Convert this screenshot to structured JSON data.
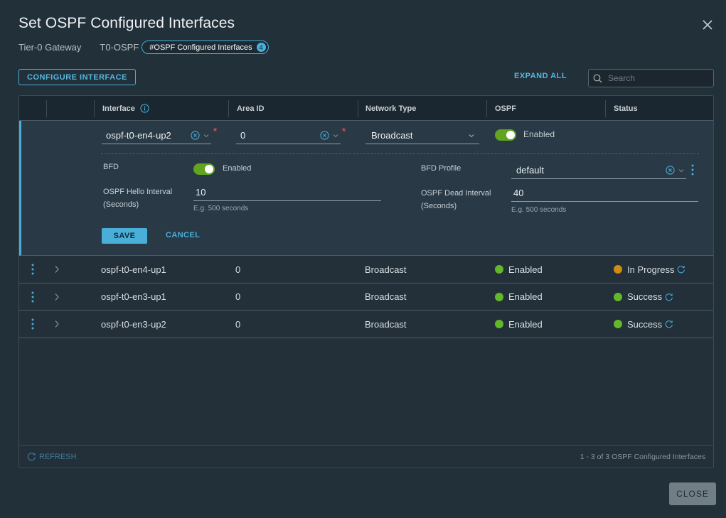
{
  "dialog": {
    "title": "Set OSPF Configured Interfaces",
    "breadcrumb": {
      "gateway_type": "Tier-0 Gateway",
      "gateway_name": "T0-OSPF",
      "pill_label": "#OSPF Configured Interfaces",
      "pill_count": "4"
    },
    "close_button": "CLOSE"
  },
  "toolbar": {
    "configure_label": "CONFIGURE INTERFACE",
    "expand_all_label": "EXPAND ALL",
    "search_placeholder": "Search",
    "search_value": ""
  },
  "grid": {
    "columns": [
      "Interface",
      "Area ID",
      "Network Type",
      "OSPF",
      "Status"
    ],
    "edit_row": {
      "interface": "ospf-t0-en4-up2",
      "area_id": "0",
      "network_type": "Broadcast",
      "ospf_toggle": true,
      "ospf_label": "Enabled",
      "bfd_label": "BFD",
      "bfd_toggle": true,
      "bfd_state": "Enabled",
      "bfd_profile_label": "BFD Profile",
      "bfd_profile_value": "default",
      "hello_label_1": "OSPF Hello Interval",
      "hello_label_2": "(Seconds)",
      "hello_value": "10",
      "hello_hint": "E.g. 500 seconds",
      "dead_label_1": "OSPF Dead Interval",
      "dead_label_2": "(Seconds)",
      "dead_value": "40",
      "dead_hint": "E.g. 500 seconds",
      "save_label": "SAVE",
      "cancel_label": "CANCEL"
    },
    "rows": [
      {
        "interface": "ospf-t0-en4-up1",
        "area_id": "0",
        "network_type": "Broadcast",
        "ospf": "Enabled",
        "ospf_color": "#62b72a",
        "status": "In Progress",
        "status_color": "#d18b0f"
      },
      {
        "interface": "ospf-t0-en3-up1",
        "area_id": "0",
        "network_type": "Broadcast",
        "ospf": "Enabled",
        "ospf_color": "#62b72a",
        "status": "Success",
        "status_color": "#62b72a"
      },
      {
        "interface": "ospf-t0-en3-up2",
        "area_id": "0",
        "network_type": "Broadcast",
        "ospf": "Enabled",
        "ospf_color": "#62b72a",
        "status": "Success",
        "status_color": "#62b72a"
      }
    ],
    "footer": {
      "refresh_label": "REFRESH",
      "count_text": "1 - 3 of 3 OSPF Configured Interfaces"
    }
  },
  "colors": {
    "accent": "#49afd9",
    "toggle_on": "#62a420",
    "required": "#e0474f"
  }
}
